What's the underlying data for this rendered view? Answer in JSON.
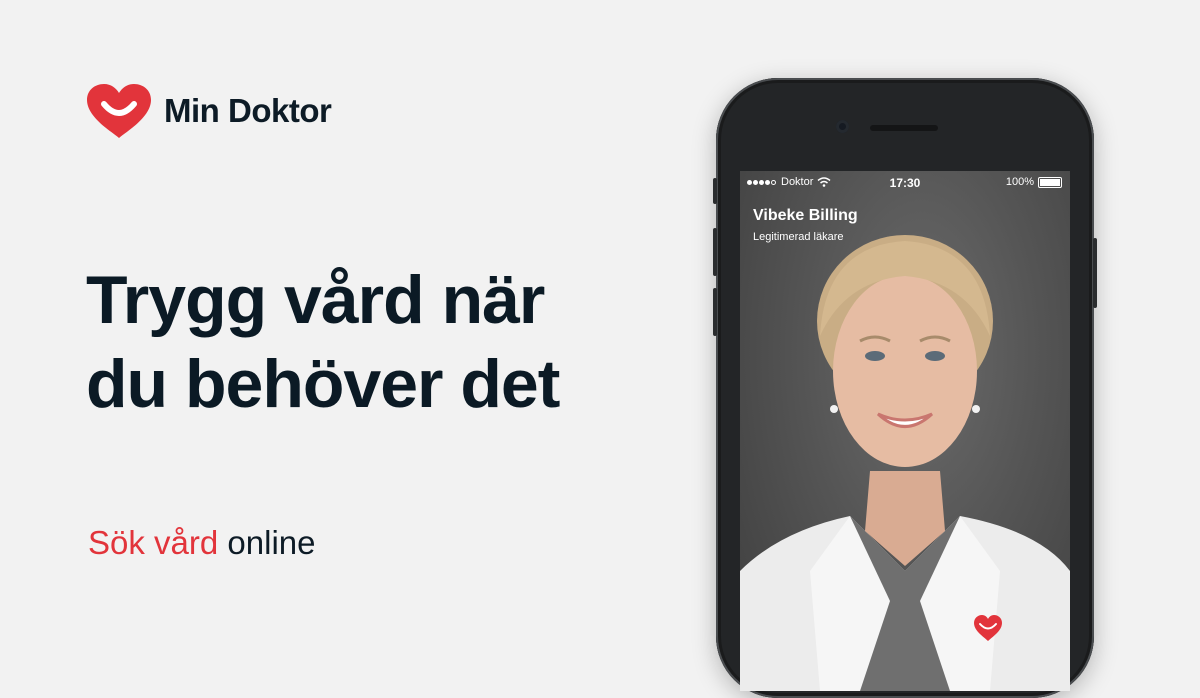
{
  "brand": {
    "name": "Min Doktor",
    "color": "#e2343b"
  },
  "headline": {
    "line1": "Trygg vård när",
    "line2": "du behöver det"
  },
  "cta": {
    "highlight": "Sök vård",
    "rest": "online"
  },
  "phone": {
    "status_bar": {
      "carrier": "Doktor",
      "time": "17:30",
      "battery": "100%"
    },
    "doctor": {
      "name": "Vibeke Billing",
      "title": "Legitimerad läkare"
    }
  }
}
